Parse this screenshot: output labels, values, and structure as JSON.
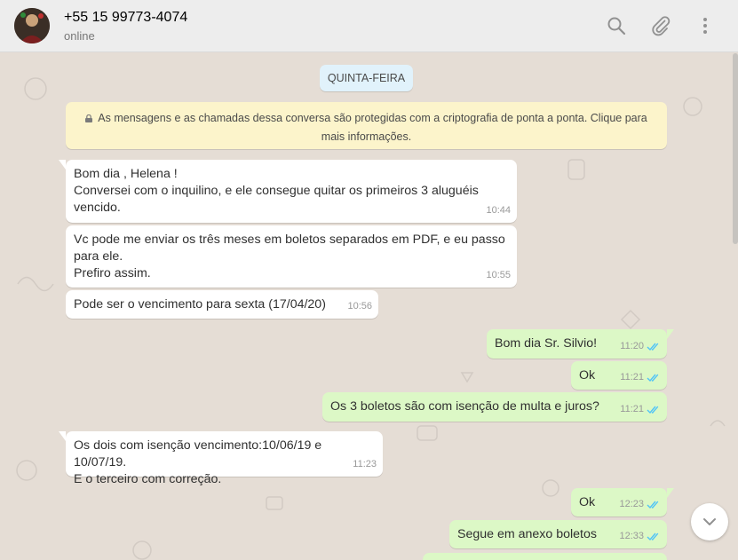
{
  "header": {
    "contact_name": "+55 15 99773-4074",
    "status": "online",
    "icons": [
      "search-icon",
      "attach-icon",
      "menu-icon"
    ]
  },
  "chat": {
    "date_chip": "QUINTA-FEIRA",
    "encryption_notice": "As mensagens e as chamadas dessa conversa são protegidas com a criptografia de ponta a ponta. Clique para mais informações.",
    "messages": [
      {
        "direction": "in",
        "text": "Bom dia , Helena !\nConversei com o inquilino, e ele consegue quitar os primeiros 3 aluguéis vencido.",
        "time": "10:44"
      },
      {
        "direction": "in",
        "text": "Vc pode me enviar os três meses em boletos separados em PDF, e eu passo para ele.\nPrefiro assim.",
        "time": "10:55"
      },
      {
        "direction": "in",
        "text": "Pode ser o vencimento para sexta (17/04/20)",
        "time": "10:56"
      },
      {
        "direction": "out",
        "text": "Bom dia Sr. Silvio!",
        "time": "11:20",
        "status": "read"
      },
      {
        "direction": "out",
        "text": "Ok",
        "time": "11:21",
        "status": "read"
      },
      {
        "direction": "out",
        "text": "Os 3 boletos são com isenção de multa e juros?",
        "time": "11:21",
        "status": "read"
      },
      {
        "direction": "in",
        "text": "Os dois com isenção vencimento:10/06/19 e 10/07/19.\nE o terceiro com correção.",
        "time": "11:23"
      },
      {
        "direction": "out",
        "text": "Ok",
        "time": "12:23",
        "status": "read"
      },
      {
        "direction": "out",
        "text": "Segue em anexo boletos",
        "time": "12:33",
        "status": "read"
      }
    ]
  },
  "colors": {
    "incoming_bubble": "#ffffff",
    "outgoing_bubble": "#dcf8c6",
    "chat_background": "#e5ddd5",
    "read_ticks": "#4fc3f7",
    "notice_background": "#fcf4cb",
    "date_chip_background": "#e1f2fb"
  },
  "scroll_down_icon": "chevron-down-icon"
}
